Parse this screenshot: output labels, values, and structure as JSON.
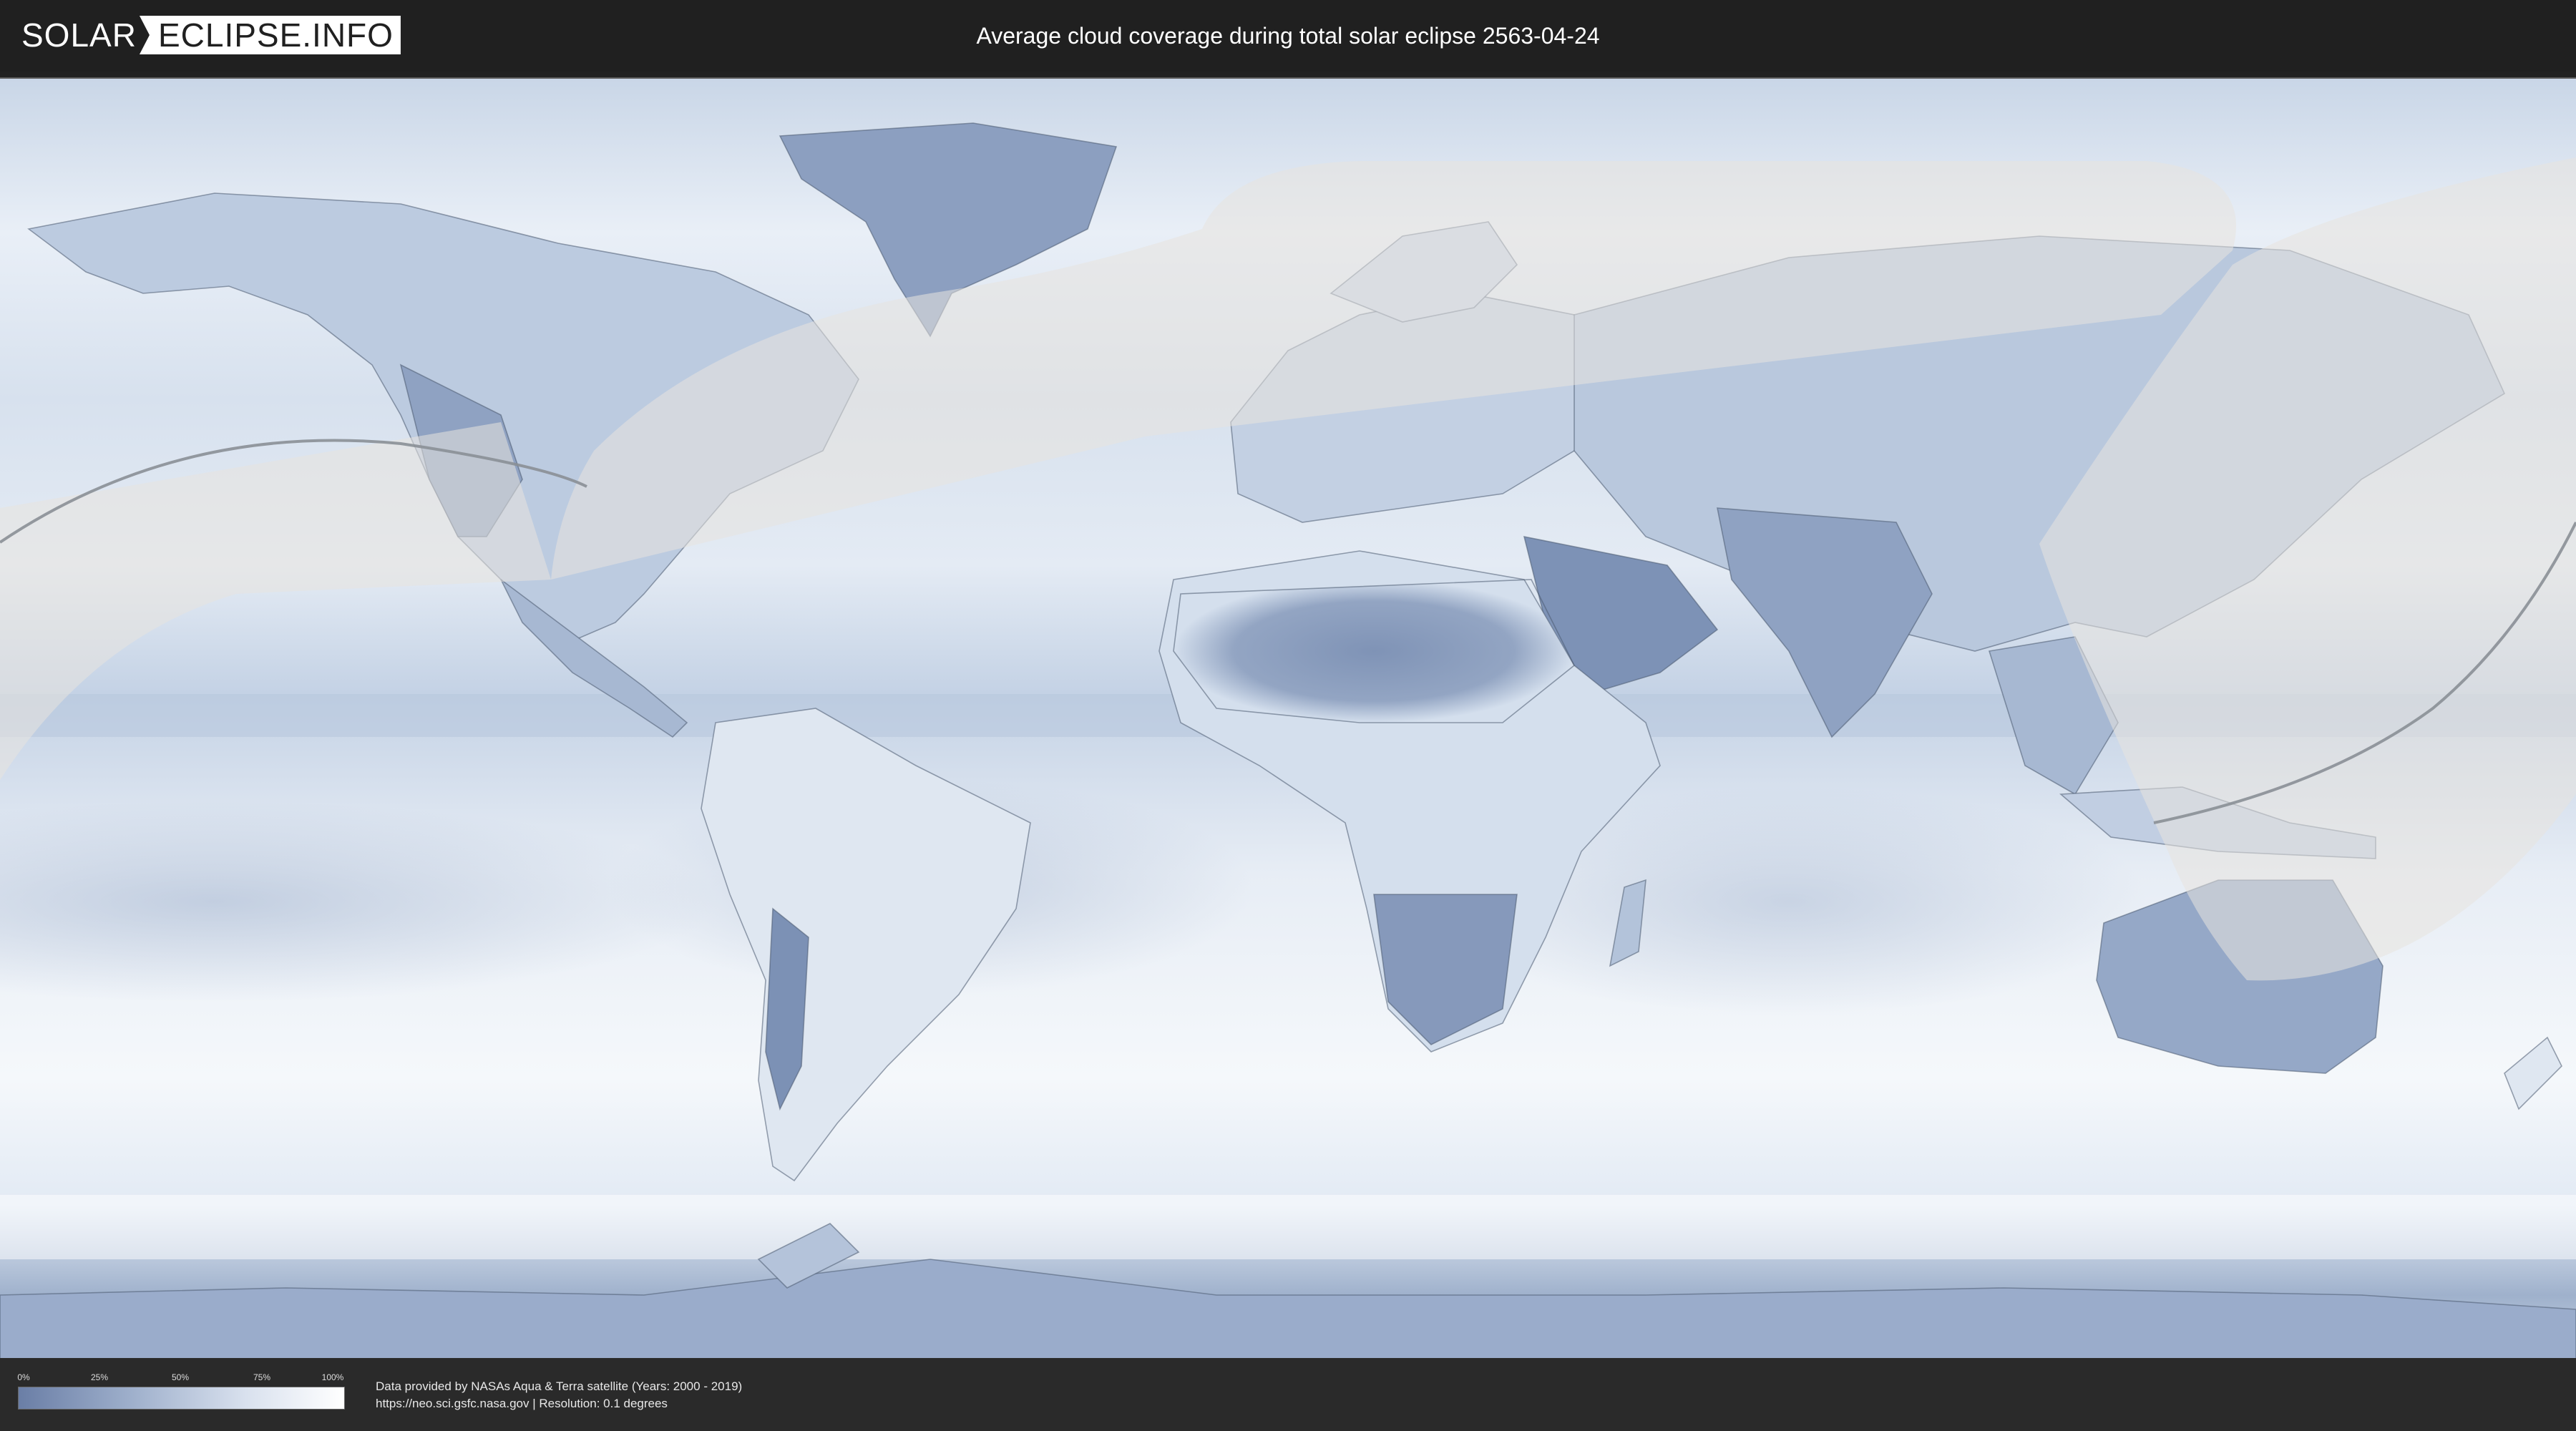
{
  "header": {
    "logo_solar": "SOLAR",
    "logo_eclipse": "ECLIPSE.INFO",
    "title": "Average cloud coverage during total solar eclipse 2563-04-24"
  },
  "map": {
    "projection": "equirectangular",
    "colors": {
      "clear_sky": "#6a7ea6",
      "overcast": "#ffffff",
      "eclipse_overlay": "#e6e2dc",
      "path_line": "#8a8f96",
      "coastline": "#4a5a70"
    }
  },
  "legend": {
    "ticks": [
      "0%",
      "25%",
      "50%",
      "75%",
      "100%"
    ]
  },
  "footer": {
    "credit_line1": "Data provided by NASAs Aqua & Terra satellite (Years: 2000 - 2019)",
    "credit_line2": "https://neo.sci.gsfc.nasa.gov | Resolution: 0.1 degrees"
  }
}
